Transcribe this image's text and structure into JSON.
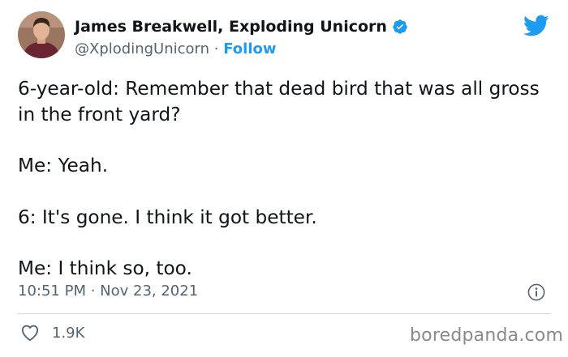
{
  "author": {
    "name": "James Breakwell, Exploding Unicorn",
    "handle": "@XplodingUnicorn",
    "separator": "·",
    "follow_label": "Follow"
  },
  "tweet": {
    "lines": [
      "6-year-old: Remember that dead bird that was all gross in the front yard?",
      "Me: Yeah.",
      "6: It's gone. I think it got better.",
      "Me: I think so, too."
    ],
    "timestamp": "10:51 PM · Nov 23, 2021"
  },
  "engagement": {
    "likes": "1.9K"
  },
  "watermark": "boredpanda.com",
  "icons": {
    "verified": "verified-badge-icon",
    "logo": "twitter-bird-icon",
    "info": "info-icon",
    "like": "heart-icon"
  },
  "colors": {
    "text": "#0f1419",
    "secondary": "#536471",
    "accent": "#1d9bf0",
    "divider": "#cfd9de"
  }
}
